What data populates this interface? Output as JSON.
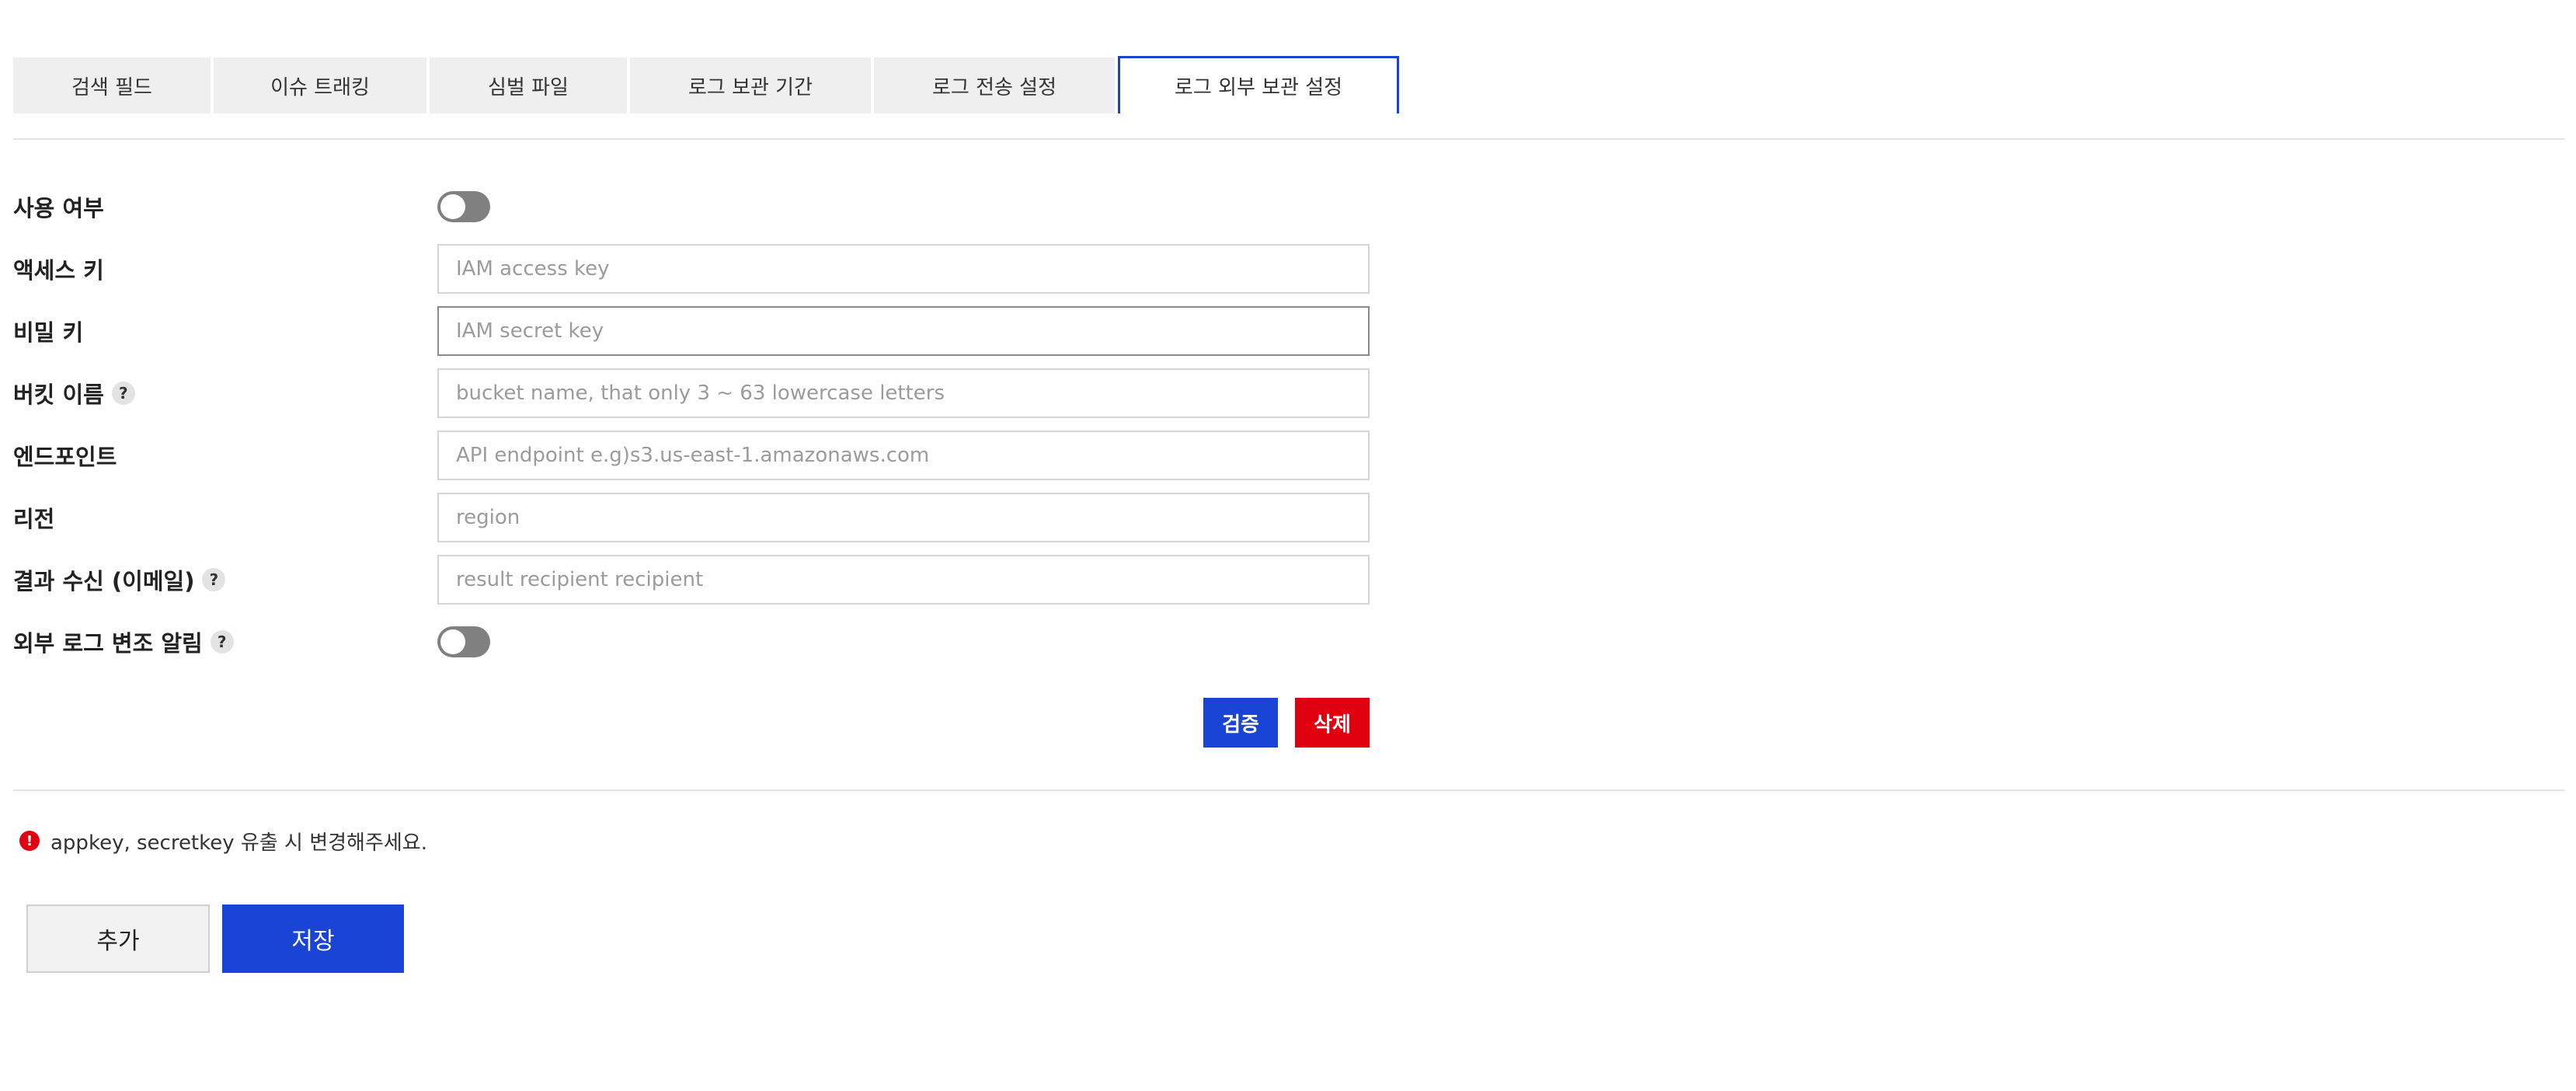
{
  "tabs": [
    {
      "label": "검색 필드"
    },
    {
      "label": "이슈 트래킹"
    },
    {
      "label": "심벌 파일"
    },
    {
      "label": "로그 보관 기간"
    },
    {
      "label": "로그 전송 설정"
    },
    {
      "label": "로그 외부 보관 설정",
      "active": true
    }
  ],
  "form": {
    "enabled": {
      "label": "사용 여부",
      "value": false
    },
    "access_key": {
      "label": "액세스 키",
      "placeholder": "IAM access key",
      "value": ""
    },
    "secret_key": {
      "label": "비밀 키",
      "placeholder": "IAM secret key",
      "value": ""
    },
    "bucket_name": {
      "label": "버킷 이름",
      "placeholder": "bucket name, that only 3 ~ 63 lowercase letters",
      "value": "",
      "help": "?"
    },
    "endpoint": {
      "label": "엔드포인트",
      "placeholder": "API endpoint e.g)s3.us-east-1.amazonaws.com",
      "value": ""
    },
    "region": {
      "label": "리전",
      "placeholder": "region",
      "value": ""
    },
    "result_recipient": {
      "label": "결과 수신 (이메일)",
      "placeholder": "result recipient recipient",
      "value": "",
      "help": "?"
    },
    "tamper_alert": {
      "label": "외부 로그 변조 알림",
      "value": false,
      "help": "?"
    }
  },
  "actions": {
    "verify_label": "검증",
    "delete_label": "삭제"
  },
  "notice": {
    "icon": "!",
    "text": "appkey, secretkey 유출 시 변경해주세요."
  },
  "footer": {
    "add_label": "추가",
    "save_label": "저장"
  },
  "colors": {
    "primary": "#1a44d6",
    "danger": "#e0000f",
    "toggle_off": "#808080"
  }
}
